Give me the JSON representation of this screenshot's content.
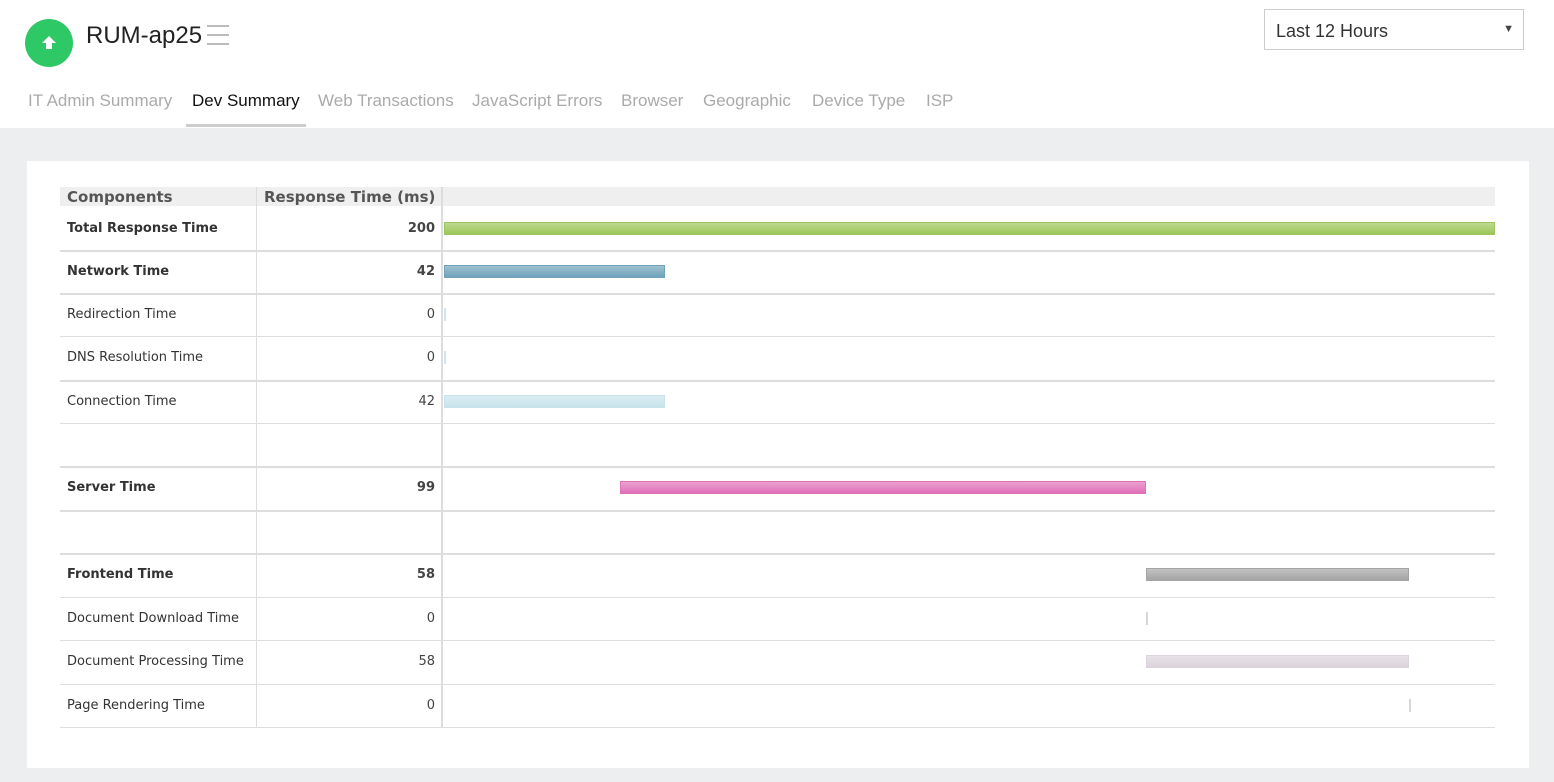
{
  "monitor": {
    "name": "RUM-ap25",
    "status": "up"
  },
  "time_range": {
    "selected": "Last 12 Hours"
  },
  "tabs": [
    {
      "label": "IT Admin Summary",
      "active": false
    },
    {
      "label": "Dev Summary",
      "active": true
    },
    {
      "label": "Web Transactions",
      "active": false
    },
    {
      "label": "JavaScript Errors",
      "active": false
    },
    {
      "label": "Browser",
      "active": false
    },
    {
      "label": "Geographic",
      "active": false
    },
    {
      "label": "Device Type",
      "active": false
    },
    {
      "label": "ISP",
      "active": false
    }
  ],
  "table": {
    "headers": {
      "components": "Components",
      "response_time": "Response Time (ms)"
    },
    "total_ms": 200,
    "rows": [
      {
        "name": "Total Response Time",
        "value": "200",
        "bold": true,
        "start": 0,
        "duration": 200,
        "color": "#9cc65a"
      },
      {
        "name": "Network Time",
        "value": "42",
        "bold": true,
        "start": 0,
        "duration": 42,
        "color": "#6fa3bb"
      },
      {
        "name": "Redirection Time",
        "value": "0",
        "bold": false,
        "start": 0,
        "duration": 0,
        "color": "#cfe6ee"
      },
      {
        "name": "DNS Resolution Time",
        "value": "0",
        "bold": false,
        "start": 0,
        "duration": 0,
        "color": "#cfe6ee"
      },
      {
        "name": "Connection Time",
        "value": "42",
        "bold": false,
        "start": 0,
        "duration": 42,
        "color": "#c9e3eb"
      },
      {
        "name": "",
        "value": "",
        "bold": false,
        "start": null,
        "duration": null,
        "color": ""
      },
      {
        "name": "Server Time",
        "value": "99",
        "bold": true,
        "start": 33.5,
        "duration": 100,
        "color": "#e070b8"
      },
      {
        "name": "",
        "value": "",
        "bold": false,
        "start": null,
        "duration": null,
        "color": ""
      },
      {
        "name": "Frontend Time",
        "value": "58",
        "bold": true,
        "start": 133.5,
        "duration": 50.2,
        "color": "#a4a4a4"
      },
      {
        "name": "Document Download Time",
        "value": "0",
        "bold": false,
        "start": 133.5,
        "duration": 0,
        "color": "#d9d3da"
      },
      {
        "name": "Document Processing Time",
        "value": "58",
        "bold": false,
        "start": 133.5,
        "duration": 50.2,
        "color": "#dcd4dc"
      },
      {
        "name": "Page Rendering Time",
        "value": "0",
        "bold": false,
        "start": 183.7,
        "duration": 0,
        "color": "#d9d3da"
      }
    ]
  }
}
